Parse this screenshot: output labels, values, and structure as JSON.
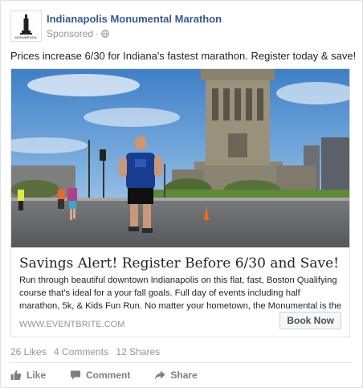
{
  "post": {
    "page_name": "Indianapolis Monumental Marathon",
    "sponsored_label": "Sponsored",
    "separator": "·",
    "text": "Prices increase 6/30 for Indiana's fastest marathon. Register today & save!",
    "logo_text": "MONUMENTAL"
  },
  "link": {
    "title": "Savings Alert! Register Before 6/30 and Save!",
    "description": "Run through beautiful downtown Indianapolis on this flat, fast, Boston Qualifying course that's ideal for a your fall goals. Full day of events including half marathon, 5k, & Kids Fun Run. No matter your hometown, the Monumental is the ideal fall…",
    "domain": "WWW.EVENTBRITE.COM",
    "cta_label": "Book Now"
  },
  "stats": {
    "likes": "26 Likes",
    "comments": "4 Comments",
    "shares": "12 Shares"
  },
  "actions": {
    "like": "Like",
    "comment": "Comment",
    "share": "Share"
  },
  "colors": {
    "brand_link": "#365899",
    "muted": "#90949c",
    "runner_shirt": "#1a3e8f"
  },
  "icons": {
    "globe": "globe-icon",
    "like": "thumbs-up-icon",
    "comment": "comment-icon",
    "share": "share-arrow-icon"
  }
}
